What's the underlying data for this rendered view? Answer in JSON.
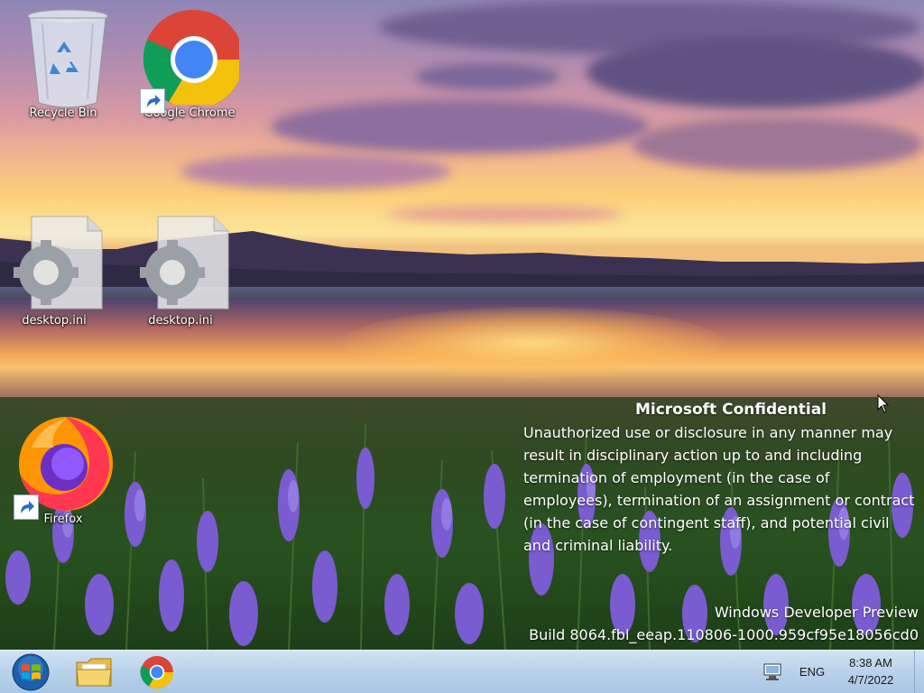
{
  "desktop": {
    "icons": [
      {
        "label": "Recycle Bin",
        "icon": "recycle-bin-icon"
      },
      {
        "label": "Google Chrome",
        "icon": "chrome-icon"
      },
      {
        "label": "desktop.ini",
        "icon": "settings-file-icon"
      },
      {
        "label": "desktop.ini",
        "icon": "settings-file-icon"
      },
      {
        "label": "Firefox",
        "icon": "firefox-icon"
      }
    ],
    "watermark": {
      "title": "Microsoft Confidential",
      "body": "Unauthorized use or disclosure in any manner may result in disciplinary action up to and including termination of employment (in the case of employees), termination of an assignment or contract (in the case of contingent staff), and potential civil and criminal liability.",
      "edition": "Windows Developer Preview",
      "build": "Build 8064.fbl_eeap.110806-1000.959cf95e18056cd0"
    }
  },
  "taskbar": {
    "pinned": [
      {
        "name": "Start",
        "icon": "windows-start-icon"
      },
      {
        "name": "File Explorer",
        "icon": "folder-icon"
      },
      {
        "name": "Google Chrome",
        "icon": "chrome-icon"
      }
    ],
    "tray": {
      "language": "ENG",
      "time": "8:38 AM",
      "date": "4/7/2022"
    }
  },
  "colors": {
    "taskbar": "#b9d2ea",
    "text": "#ffffff"
  }
}
